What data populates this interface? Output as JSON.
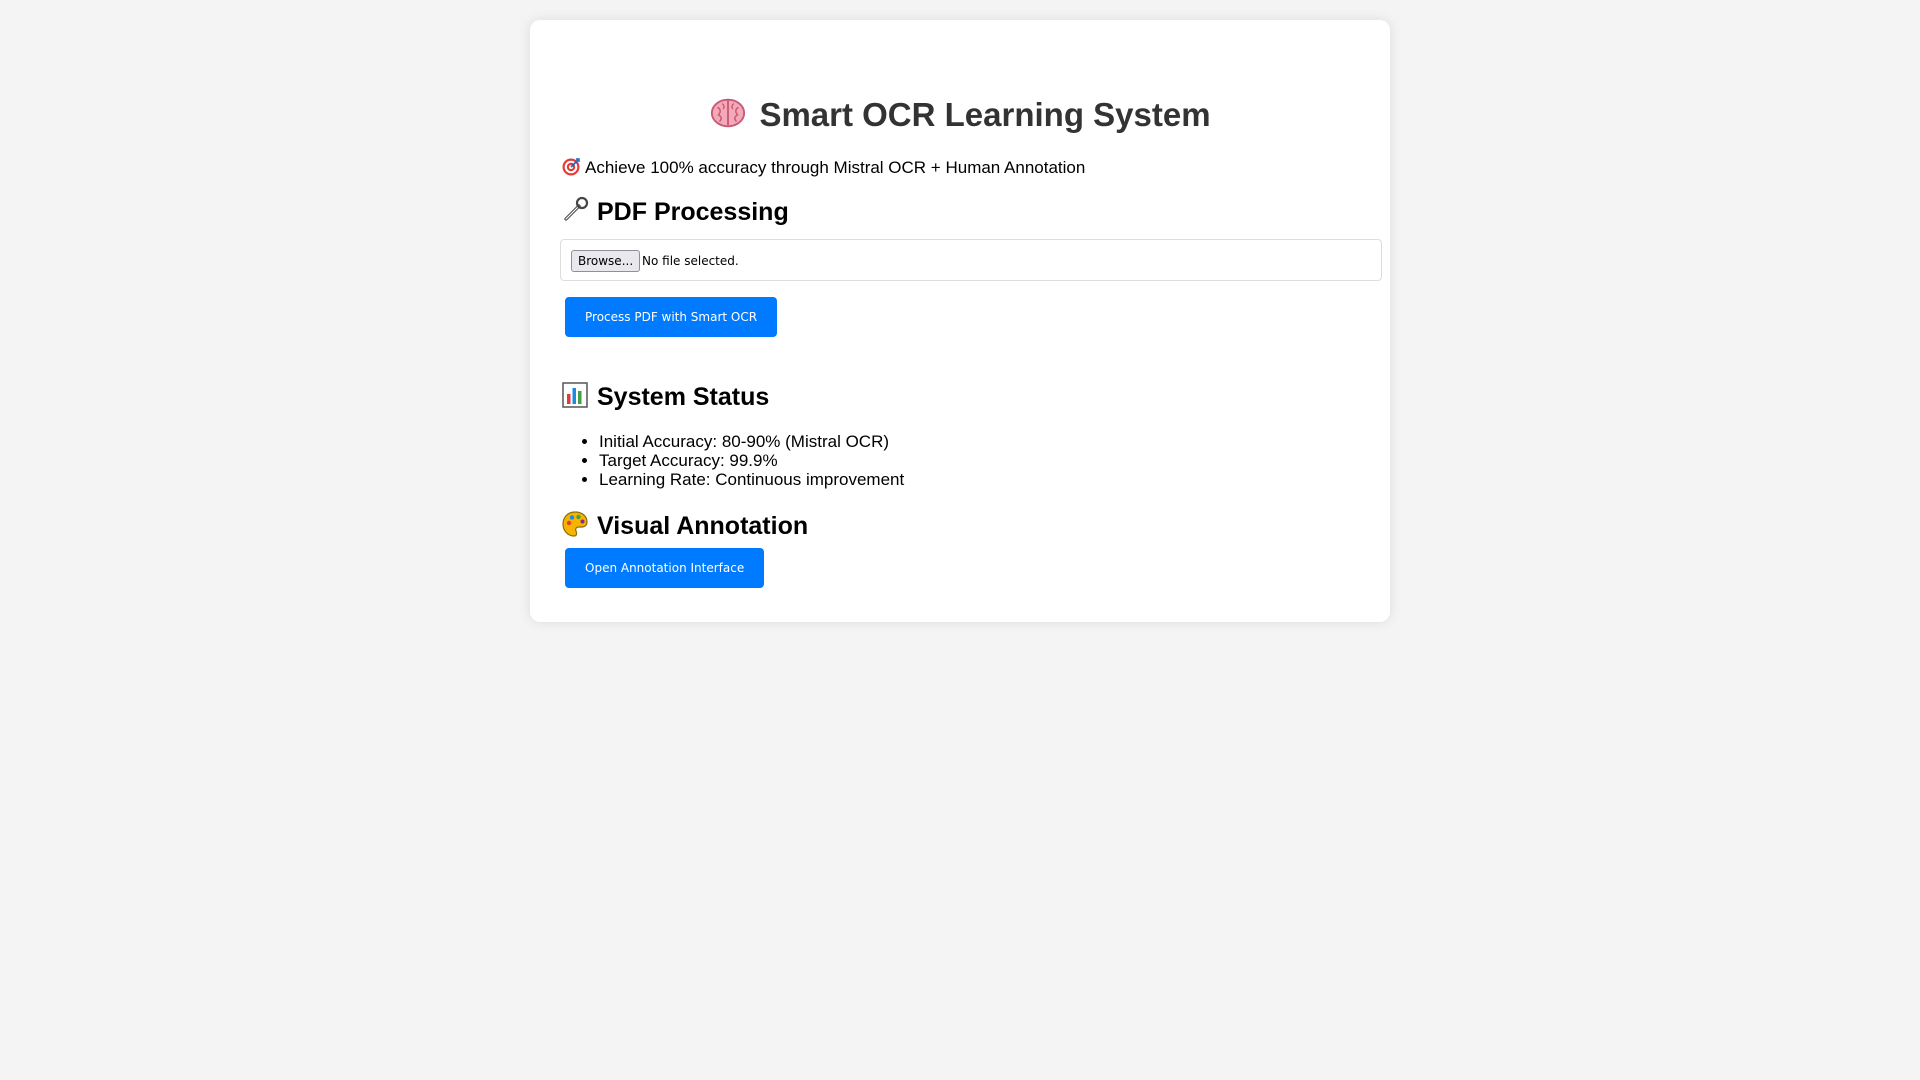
{
  "header": {
    "title": "Smart OCR Learning System",
    "title_icon": "brain-icon"
  },
  "tagline": {
    "icon": "target-icon",
    "text": "Achieve 100% accuracy through Mistral OCR + Human Annotation"
  },
  "pdf_processing": {
    "heading": "PDF Processing",
    "icon": "wrench-icon",
    "browse_label": "Browse...",
    "file_status": "No file selected.",
    "process_button": "Process PDF with Smart OCR"
  },
  "system_status": {
    "heading": "System Status",
    "icon": "bar-chart-icon",
    "items": [
      "Initial Accuracy: 80-90% (Mistral OCR)",
      "Target Accuracy: 99.9%",
      "Learning Rate: Continuous improvement"
    ]
  },
  "visual_annotation": {
    "heading": "Visual Annotation",
    "icon": "palette-icon",
    "button": "Open Annotation Interface"
  },
  "colors": {
    "page_background": "#f4f4f4",
    "card_background": "#ffffff",
    "primary_button": "#007bff",
    "title_text": "#333333"
  }
}
